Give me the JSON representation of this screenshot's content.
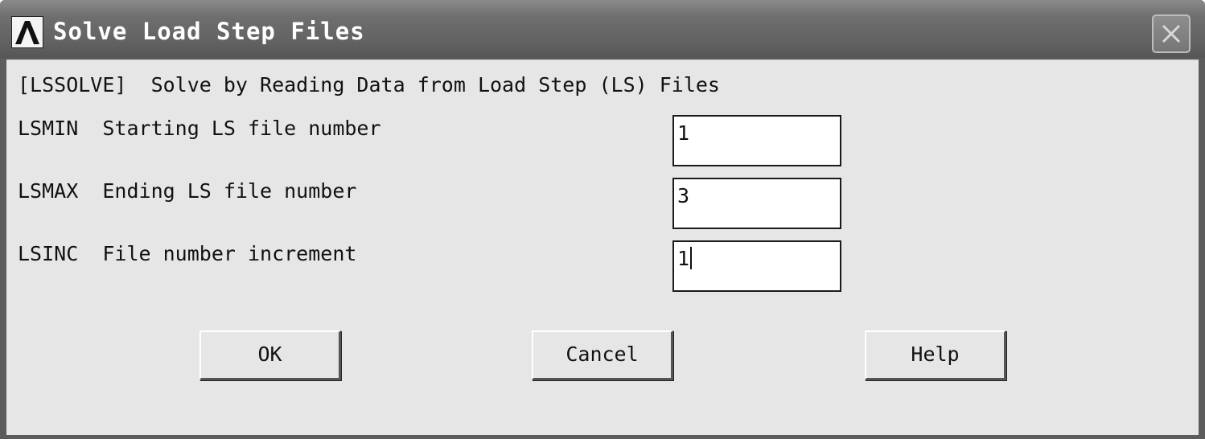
{
  "window": {
    "title": "Solve Load Step Files",
    "close_icon": "close-icon",
    "app_icon": "ansys-logo-icon"
  },
  "dialog": {
    "header": "[LSSOLVE]  Solve by Reading Data from Load Step (LS) Files",
    "rows": [
      {
        "label": "LSMIN  Starting LS file number",
        "value": "1"
      },
      {
        "label": "LSMAX  Ending LS file number",
        "value": "3"
      },
      {
        "label": "LSINC  File number increment",
        "value": "1"
      }
    ]
  },
  "buttons": {
    "ok": "OK",
    "cancel": "Cancel",
    "help": "Help"
  },
  "colors": {
    "titlebar": "#636363",
    "client_background": "#e6e6e6",
    "title_text": "#ffffff"
  }
}
